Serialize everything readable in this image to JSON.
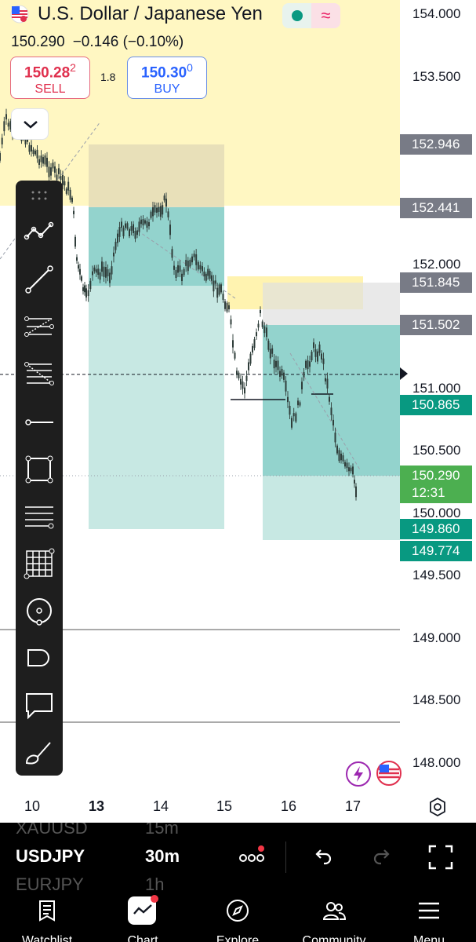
{
  "header": {
    "pair_title": "U.S. Dollar / Japanese Yen",
    "last_price": "150.290",
    "change": "−0.146 (−0.10%)"
  },
  "trade": {
    "sell_price_main": "150.28",
    "sell_price_small": "2",
    "sell_label": "SELL",
    "spread": "1.8",
    "buy_price_main": "150.30",
    "buy_price_small": "0",
    "buy_label": "BUY"
  },
  "price_axis": {
    "ticks": [
      "154.000",
      "153.500",
      "152.000",
      "151.000",
      "150.500",
      "150.000",
      "149.500",
      "149.000",
      "148.500",
      "148.000"
    ],
    "tags": [
      {
        "label": "152.946",
        "style": "gray"
      },
      {
        "label": "152.441",
        "style": "gray"
      },
      {
        "label": "151.845",
        "style": "gray"
      },
      {
        "label": "151.502",
        "style": "gray"
      },
      {
        "label": "150.865",
        "style": "green"
      },
      {
        "label": "150.290",
        "sub": "12:31",
        "style": "lime"
      },
      {
        "label": "149.860",
        "style": "green"
      },
      {
        "label": "149.774",
        "style": "green"
      }
    ]
  },
  "time_axis": {
    "ticks": [
      {
        "label": "10",
        "bold": false
      },
      {
        "label": "13",
        "bold": true
      },
      {
        "label": "14",
        "bold": false
      },
      {
        "label": "15",
        "bold": false
      },
      {
        "label": "16",
        "bold": false
      },
      {
        "label": "17",
        "bold": false
      }
    ]
  },
  "watchlist": {
    "prev": {
      "symbol": "XAUUSD",
      "interval": "15m"
    },
    "active": {
      "symbol": "USDJPY",
      "interval": "30m"
    },
    "next": {
      "symbol": "EURJPY",
      "interval": "1h"
    }
  },
  "nav": {
    "items": [
      {
        "label": "Watchlist",
        "icon": "watchlist-icon"
      },
      {
        "label": "Chart",
        "icon": "chart-icon"
      },
      {
        "label": "Explore",
        "icon": "compass-icon"
      },
      {
        "label": "Community",
        "icon": "community-icon"
      },
      {
        "label": "Menu",
        "icon": "menu-icon"
      }
    ]
  },
  "tools": [
    "trend-icon",
    "line-icon",
    "pitchfork-icon",
    "fib-icon",
    "ray-icon",
    "rectangle-icon",
    "parallel-lines-icon",
    "grid-icon",
    "circle-icon",
    "shape-icon",
    "callout-icon",
    "brush-icon"
  ],
  "colors": {
    "up": "#089981",
    "down": "#f23645",
    "accent": "#2962ff",
    "zone_yellow": "#fff7c2",
    "zone_green": "#b2dfdb",
    "toolbar_bg": "#1e1e1e"
  }
}
